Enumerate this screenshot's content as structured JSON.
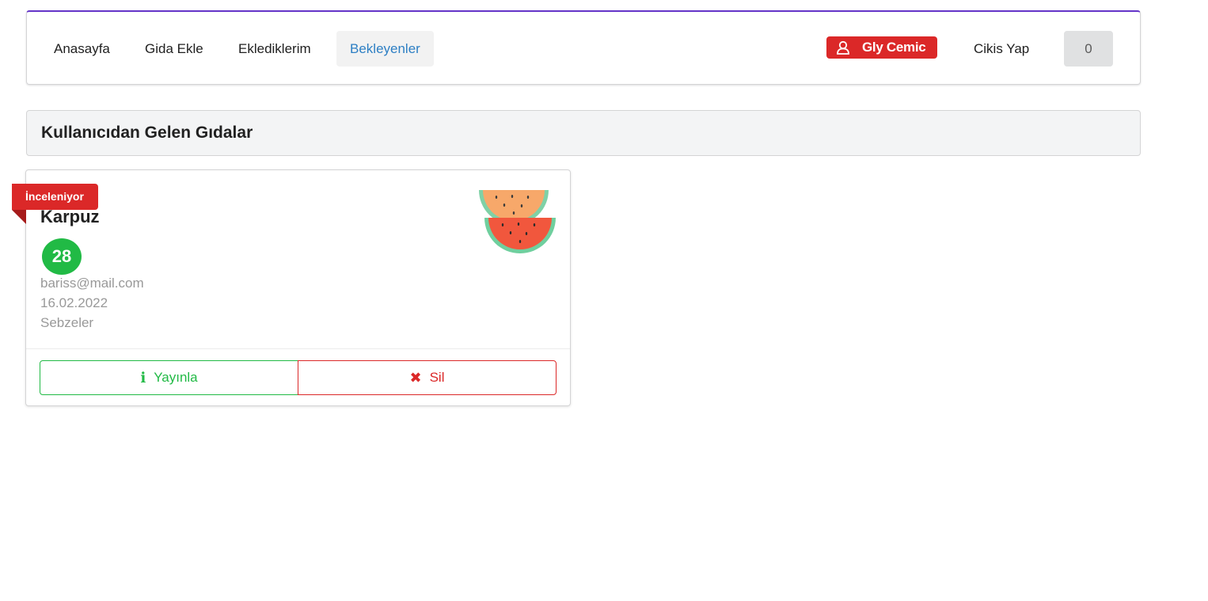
{
  "nav": {
    "items": [
      {
        "label": "Anasayfa",
        "active": false
      },
      {
        "label": "Gida Ekle",
        "active": false
      },
      {
        "label": "Eklediklerim",
        "active": false
      },
      {
        "label": "Bekleyenler",
        "active": true
      }
    ],
    "user_name": "Gly Cemic",
    "logout_label": "Cikis Yap",
    "counter": "0"
  },
  "section": {
    "title": "Kullanıcıdan Gelen Gıdalar"
  },
  "card": {
    "status": "İnceleniyor",
    "title": "Karpuz",
    "score": "28",
    "email": "bariss@mail.com",
    "date": "16.02.2022",
    "category": "Sebzeler",
    "image_icon": "watermelon-icon",
    "publish_label": "Yayınla",
    "delete_label": "Sil"
  },
  "colors": {
    "accent_purple": "#6435c9",
    "red": "#db2828",
    "green": "#21ba45",
    "active_blue": "#2d7fc4"
  }
}
